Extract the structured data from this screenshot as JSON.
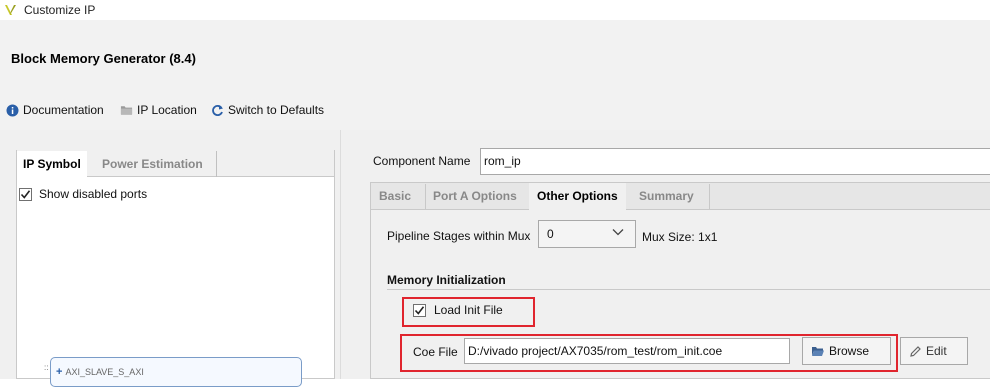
{
  "window": {
    "title": "Customize IP",
    "logo_icon": "vivado-logo-icon"
  },
  "header": {
    "title": "Block Memory Generator (8.4)"
  },
  "toolbar": {
    "documentation": {
      "label": "Documentation",
      "icon": "info-icon"
    },
    "ip_location": {
      "label": "IP Location",
      "icon": "folder-icon"
    },
    "switch_defaults": {
      "label": "Switch to Defaults",
      "icon": "refresh-icon"
    }
  },
  "left_panel": {
    "tabs": [
      {
        "label": "IP Symbol",
        "active": true
      },
      {
        "label": "Power Estimation",
        "active": false
      }
    ],
    "show_disabled_ports": {
      "label": "Show disabled ports",
      "checked": true
    },
    "symbol": {
      "port_label": "AXI_SLAVE_S_AXI",
      "dots": "::"
    }
  },
  "right_panel": {
    "component_name": {
      "label": "Component Name",
      "value": "rom_ip"
    },
    "tabs": [
      {
        "label": "Basic",
        "active": false
      },
      {
        "label": "Port A Options",
        "active": false
      },
      {
        "label": "Other Options",
        "active": true
      },
      {
        "label": "Summary",
        "active": false
      }
    ],
    "pipeline": {
      "label": "Pipeline Stages within Mux",
      "value": "0"
    },
    "mux_size": "Mux Size: 1x1",
    "memory_init": {
      "title": "Memory Initialization",
      "load_init": {
        "label": "Load Init File",
        "checked": true
      },
      "coe_file": {
        "label": "Coe File",
        "value": "D:/vivado project/AX7035/rom_test/rom_init.coe"
      },
      "browse_label": "Browse",
      "edit_label": "Edit"
    }
  },
  "colors": {
    "highlight_box": "#e0252e",
    "panel_bg": "#f0f0f0",
    "header_bg": "#f2f2f2"
  }
}
